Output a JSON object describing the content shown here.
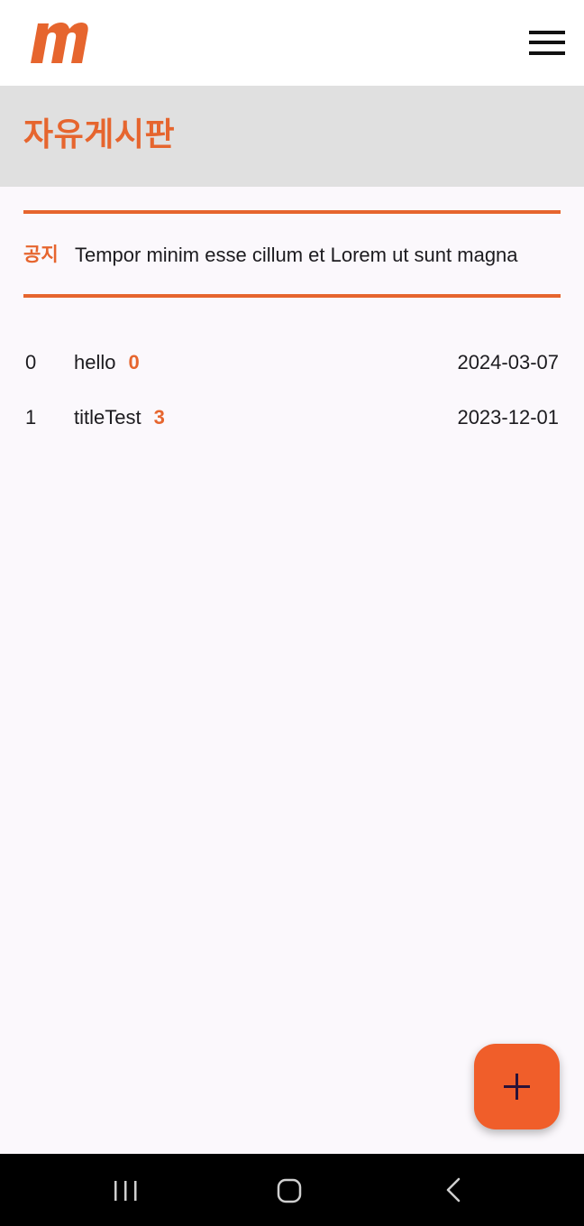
{
  "header": {
    "logo_icon": "m-logo-icon",
    "menu_icon": "hamburger-menu-icon"
  },
  "board": {
    "title": "자유게시판"
  },
  "notice": {
    "tag": "공지",
    "text": "Tempor minim esse cillum et Lorem ut sunt magna"
  },
  "posts": [
    {
      "index": "0",
      "title": "hello",
      "comments": "0",
      "date": "2024-03-07"
    },
    {
      "index": "1",
      "title": "titleTest",
      "comments": "3",
      "date": "2023-12-01"
    }
  ],
  "fab": {
    "icon": "plus-icon"
  },
  "nav": {
    "recents_icon": "recent-apps-icon",
    "home_icon": "home-icon",
    "back_icon": "back-icon"
  },
  "colors": {
    "accent": "#e6652e",
    "fab": "#f05e2a",
    "header_band": "#e0e0e0",
    "background": "#fbf8fc"
  }
}
